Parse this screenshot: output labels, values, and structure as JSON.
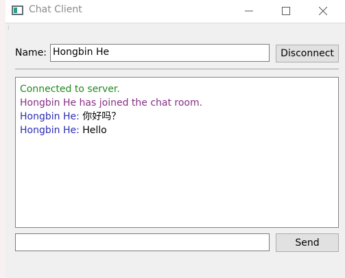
{
  "window": {
    "title": "Chat Client",
    "icon": "app-window-icon"
  },
  "controls": {
    "minimize_icon": "minimize-icon",
    "maximize_icon": "maximize-icon",
    "close_icon": "close-icon"
  },
  "name_row": {
    "label": "Name:",
    "input_value": "Hongbin He",
    "disconnect_label": "Disconnect"
  },
  "chat": {
    "messages": [
      {
        "type": "system",
        "color": "#1e8a1e",
        "text": "Connected to server."
      },
      {
        "type": "system",
        "color": "#862d86",
        "text": "Hongbin He has joined the chat room."
      },
      {
        "type": "message",
        "sender": "Hongbin He",
        "separator": ": ",
        "text": "你好吗？",
        "sender_color": "#2b2bb8"
      },
      {
        "type": "message",
        "sender": "Hongbin He",
        "separator": ": ",
        "text": "Hello",
        "sender_color": "#2b2bb8"
      }
    ]
  },
  "compose": {
    "input_value": "",
    "send_label": "Send"
  }
}
